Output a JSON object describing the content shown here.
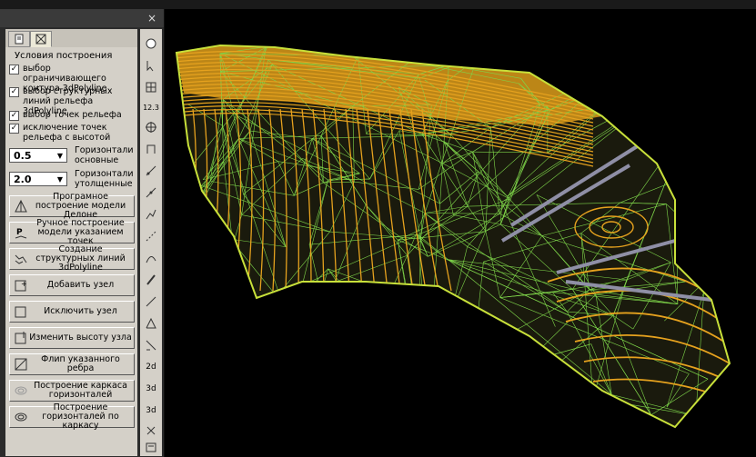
{
  "panel": {
    "close_glyph": "×",
    "tabs": [
      {
        "icon": "page-icon"
      },
      {
        "icon": "box-x-icon"
      }
    ],
    "section_title": "Условия построения",
    "checkboxes": [
      {
        "label": "выбор ограничивающего контура 3dPolyline",
        "checked": true
      },
      {
        "label": "выбор структурных линий рельефа 3dPolyline",
        "checked": true
      },
      {
        "label": "выбор точек рельефа",
        "checked": true
      },
      {
        "label": "исключение точек рельефа с высотой",
        "checked": true
      }
    ],
    "contours": [
      {
        "value": "0.5",
        "label": "Горизонтали основные"
      },
      {
        "value": "2.0",
        "label": "Горизонтали утолщенные"
      }
    ],
    "buttons": [
      {
        "label": "Програмное построение модели Делоне",
        "icon": "delaunay-icon"
      },
      {
        "label": "Ручное построение модели указанием точек",
        "icon": "manual-build-icon"
      },
      {
        "label": "Создание структурных линий 3dPolyline",
        "icon": "structure-lines-icon"
      },
      {
        "label": "Добавить узел",
        "icon": "add-node-icon"
      },
      {
        "label": "Исключить узел",
        "icon": "remove-node-icon"
      },
      {
        "label": "Изменить высоту узла",
        "icon": "node-height-icon"
      },
      {
        "label": "Флип указанного ребра",
        "icon": "flip-edge-icon"
      },
      {
        "label": "Построение каркаса горизонталей",
        "icon": "contour-frame-icon"
      },
      {
        "label": "Построение горизонталей по каркасу",
        "icon": "contour-build-icon"
      }
    ]
  },
  "toolbar": {
    "label_123": "12.3",
    "label_2d": "2d",
    "label_3d_a": "3d",
    "label_3d_b": "3d"
  },
  "colors": {
    "terrain_fill": "#d99a1a",
    "mesh": "#7fd64a",
    "boundary": "#c8e03a",
    "contour": "#e6a21e",
    "structure_lines": "#8f8fa6"
  }
}
